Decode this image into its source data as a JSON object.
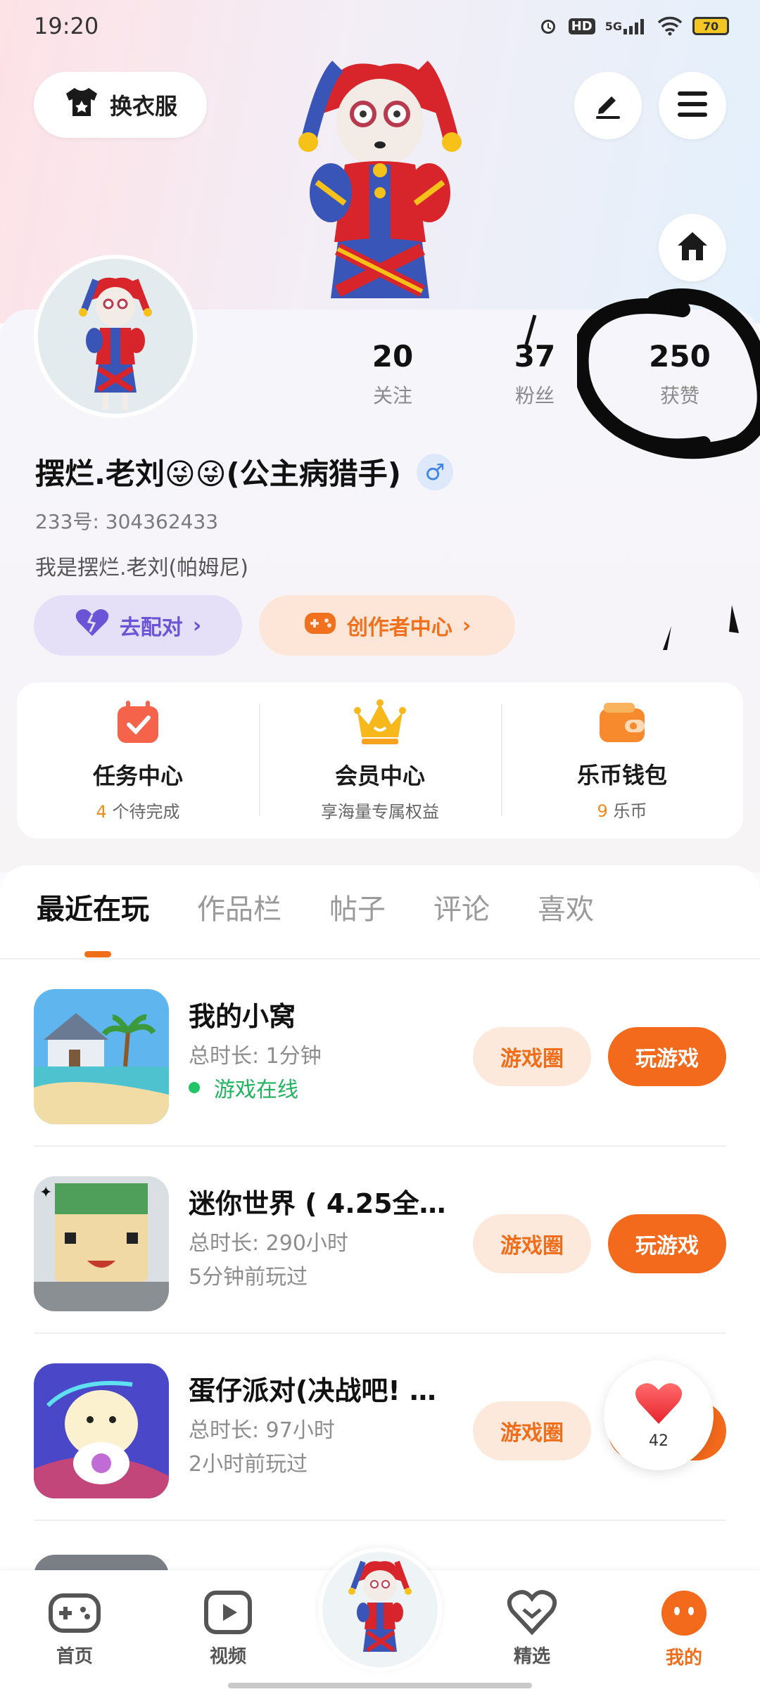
{
  "status_bar": {
    "time": "19:20",
    "hd": "HD",
    "network": "5G",
    "battery": "70"
  },
  "header": {
    "outfit_label": "换衣服"
  },
  "stats": [
    {
      "value": "20",
      "label": "关注"
    },
    {
      "value": "37",
      "label": "粉丝"
    },
    {
      "value": "250",
      "label": "获赞"
    }
  ],
  "profile": {
    "username": "摆烂.老刘😜😜(公主病猎手)",
    "gender_symbol": "♂",
    "uid": "233号: 304362433",
    "bio": "我是摆烂.老刘(帕姆尼)",
    "pair_label": "去配对",
    "creator_label": "创作者中心"
  },
  "services": [
    {
      "title": "任务中心",
      "count": "4",
      "sub": "个待完成"
    },
    {
      "title": "会员中心",
      "sub": "享海量专属权益"
    },
    {
      "title": "乐币钱包",
      "count": "9",
      "sub": "乐币"
    }
  ],
  "tabs": [
    "最近在玩",
    "作品栏",
    "帖子",
    "评论",
    "喜欢"
  ],
  "games": [
    {
      "title": "我的小窝",
      "duration": "总时长: 1分钟",
      "status": "游戏在线",
      "circle_label": "游戏圈",
      "play_label": "玩游戏"
    },
    {
      "title": "迷你世界 ( 4.25全新…",
      "duration": "总时长: 290小时",
      "last_played": "5分钟前玩过",
      "circle_label": "游戏圈",
      "play_label": "玩游戏"
    },
    {
      "title": "蛋仔派对(决战吧! …",
      "duration": "总时长: 97小时",
      "last_played": "2小时前玩过",
      "circle_label": "游戏圈"
    }
  ],
  "like_float": {
    "count": "42"
  },
  "nav": [
    {
      "label": "首页"
    },
    {
      "label": "视频"
    },
    {
      "label": "精选"
    },
    {
      "label": "我的"
    }
  ],
  "colors": {
    "accent": "#f46a1c",
    "pair": "#6b55d6",
    "online": "#21b35e"
  }
}
